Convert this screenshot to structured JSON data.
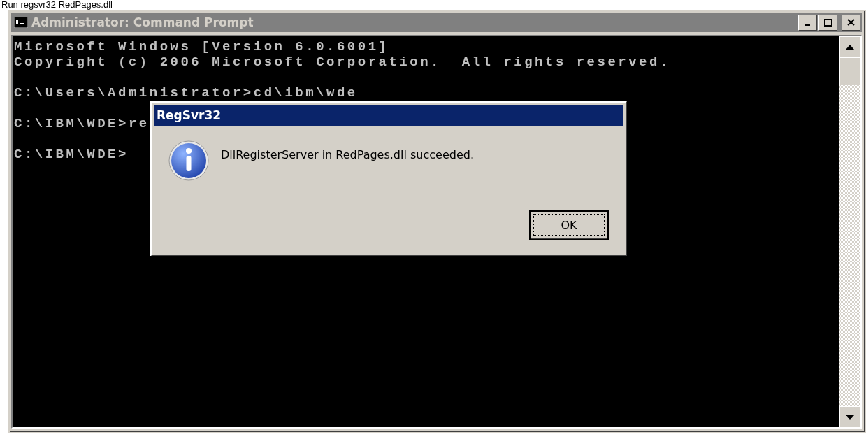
{
  "caption": "Run regsvr32 RedPages.dll",
  "window": {
    "title": "Administrator: Command Prompt",
    "active": false
  },
  "console": {
    "paragraphs": [
      {
        "lines": [
          "Microsoft Windows [Version 6.0.6001]",
          "Copyright (c) 2006 Microsoft Corporation.  All rights reserved."
        ]
      },
      {
        "lines": [
          "C:\\Users\\Administrator>cd\\ibm\\wde"
        ]
      },
      {
        "lines": [
          "C:\\IBM\\WDE>re"
        ]
      },
      {
        "lines": [
          "C:\\IBM\\WDE>"
        ]
      }
    ]
  },
  "dialog": {
    "title": "RegSvr32",
    "kind": "info",
    "message": "DllRegisterServer in RedPages.dll succeeded.",
    "buttons": [
      "OK"
    ]
  }
}
